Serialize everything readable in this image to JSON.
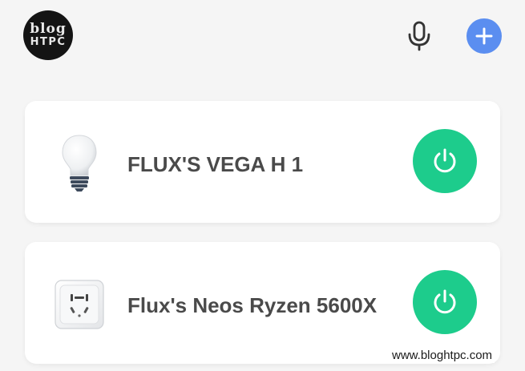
{
  "header": {
    "avatar": {
      "line1": "blog",
      "line2": "HTPC"
    },
    "mic_icon": "microphone-icon",
    "add_icon": "plus-icon",
    "accent_color": "#5b8ef0"
  },
  "devices": [
    {
      "name": "FLUX'S VEGA H 1",
      "icon": "light-bulb-icon",
      "power_icon": "power-icon",
      "power_color": "#1dcc8c"
    },
    {
      "name": "Flux's Neos Ryzen 5600X",
      "icon": "smart-plug-icon",
      "power_icon": "power-icon",
      "power_color": "#1dcc8c"
    }
  ],
  "watermark": "www.bloghtpc.com"
}
